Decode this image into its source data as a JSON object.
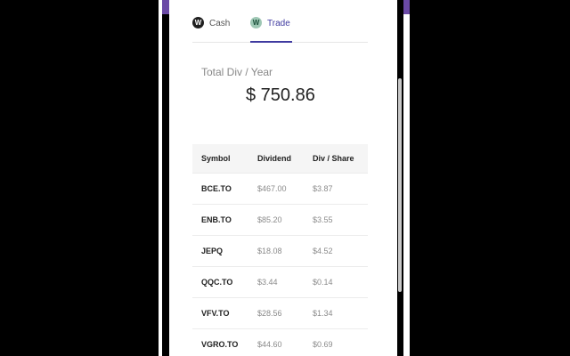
{
  "tabs": {
    "cash": {
      "label": "Cash",
      "logo": "W"
    },
    "trade": {
      "label": "Trade",
      "logo": "W"
    }
  },
  "summary": {
    "label": "Total Div / Year",
    "value": "$ 750.86"
  },
  "table": {
    "headers": {
      "symbol": "Symbol",
      "dividend": "Dividend",
      "per_share": "Div / Share"
    },
    "rows": [
      {
        "symbol": "BCE.TO",
        "dividend": "$467.00",
        "per_share": "$3.87"
      },
      {
        "symbol": "ENB.TO",
        "dividend": "$85.20",
        "per_share": "$3.55"
      },
      {
        "symbol": "JEPQ",
        "dividend": "$18.08",
        "per_share": "$4.52"
      },
      {
        "symbol": "QQC.TO",
        "dividend": "$3.44",
        "per_share": "$0.14"
      },
      {
        "symbol": "VFV.TO",
        "dividend": "$28.56",
        "per_share": "$1.34"
      },
      {
        "symbol": "VGRO.TO",
        "dividend": "$44.60",
        "per_share": "$0.69"
      }
    ]
  },
  "colors": {
    "accent": "#3f3aa0",
    "background_bar": "#6b4aa6"
  }
}
